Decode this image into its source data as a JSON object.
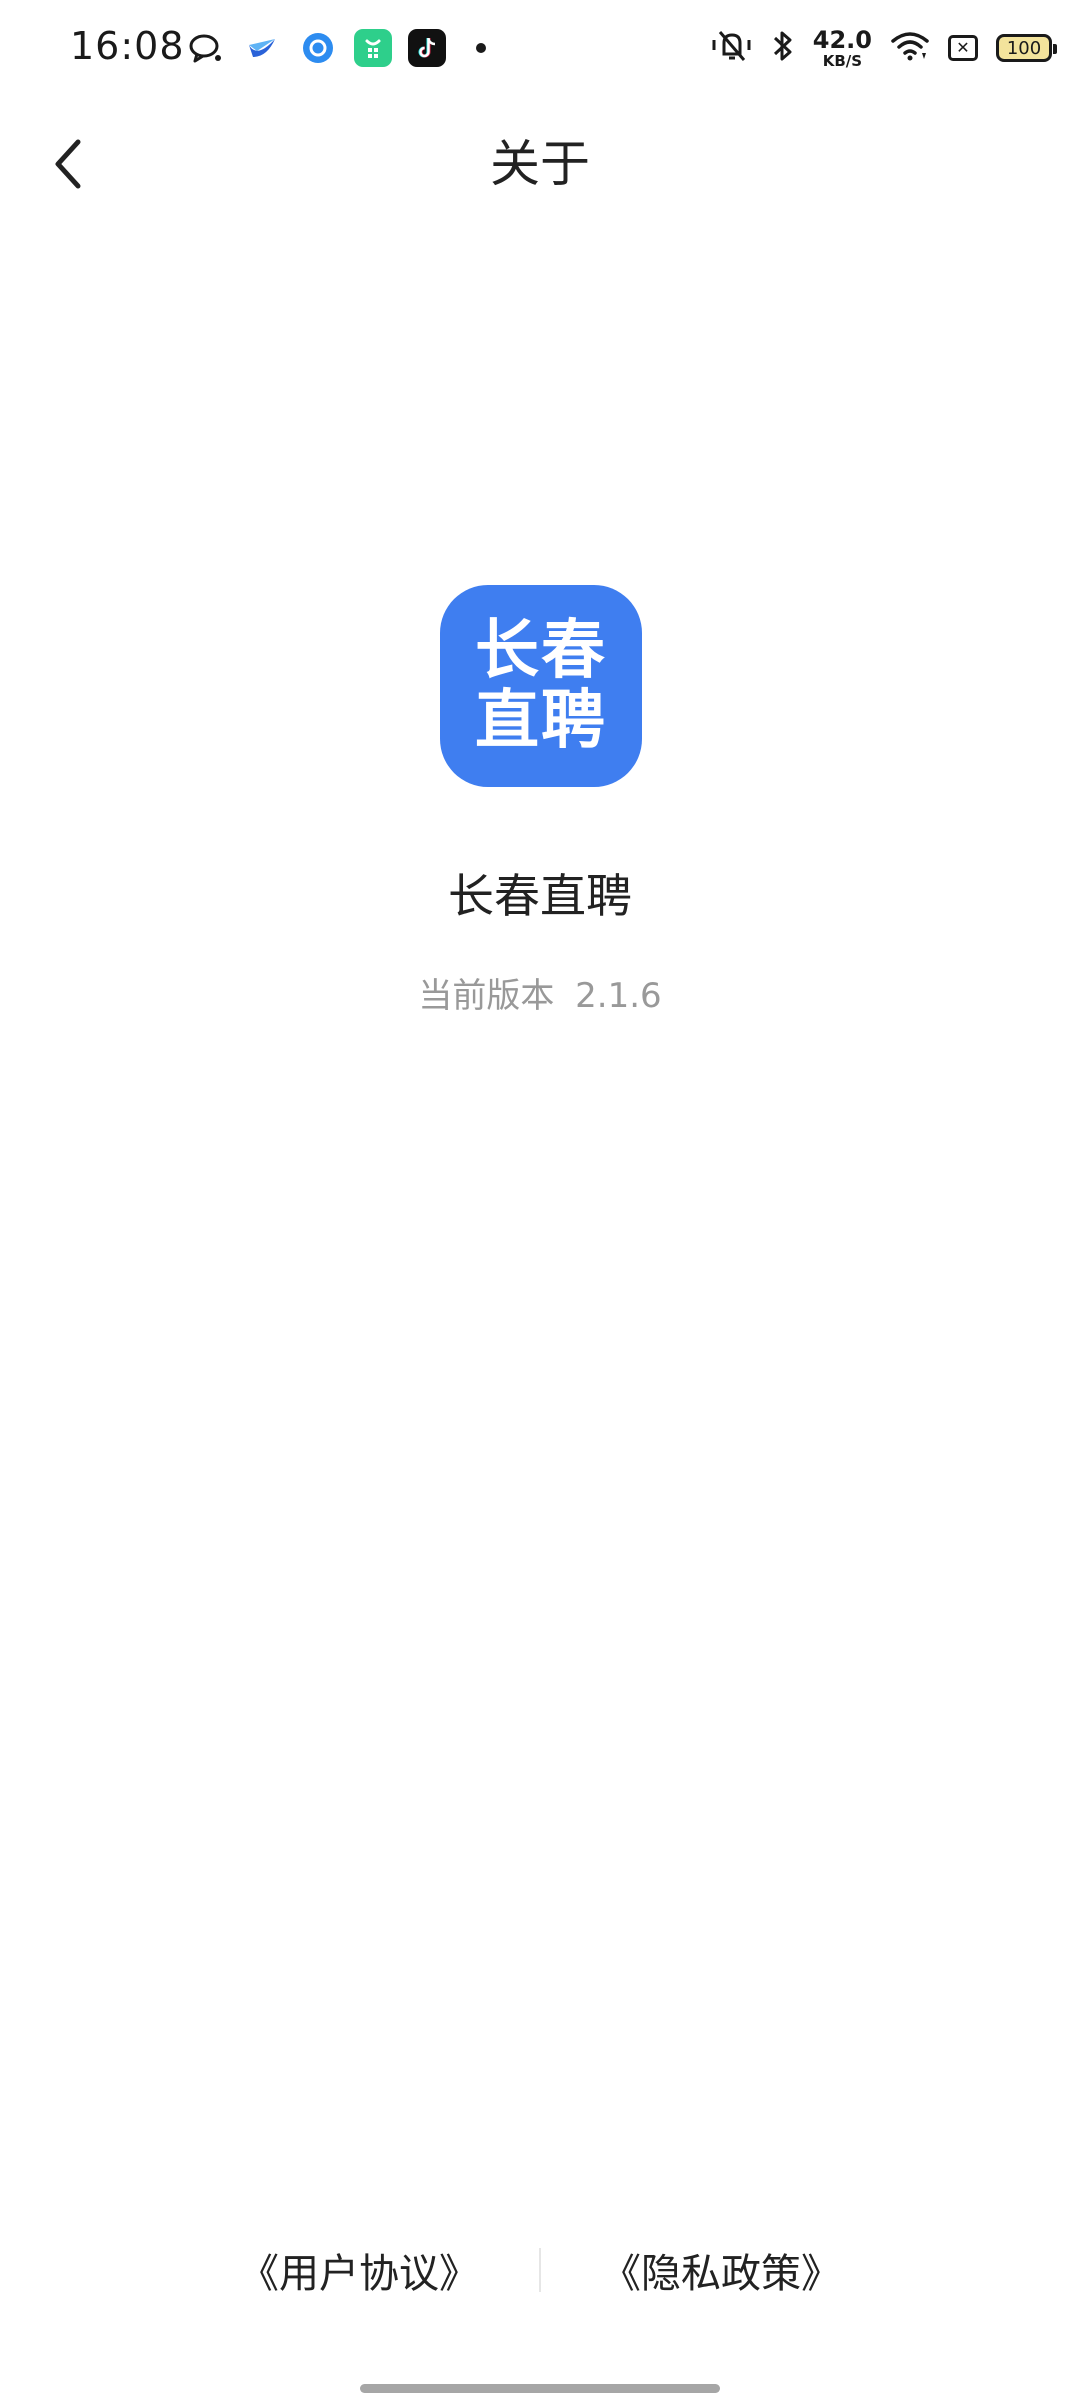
{
  "status_bar": {
    "time": "16:08",
    "net_speed_value": "42.0",
    "net_speed_unit": "KB/S",
    "battery_level": "100",
    "notification_icons": [
      "bubble-chat-icon",
      "blue-bird-app-icon",
      "blue-circle-app-icon",
      "green-shopping-app-icon",
      "tiktok-icon"
    ],
    "status_icons": [
      "mute-icon",
      "bluetooth-icon",
      "wifi-icon",
      "sim-none-icon",
      "battery-icon"
    ],
    "colors": {
      "battery_fill": "#f3e39c",
      "green_app": "#2ecf8b",
      "tiktok_bg": "#111111"
    }
  },
  "nav": {
    "title": "关于",
    "back_icon": "chevron-left-icon"
  },
  "app": {
    "logo_line1": "长春",
    "logo_line2": "直聘",
    "name": "长春直聘",
    "version_label": "当前版本",
    "version_number": "2.1.6",
    "brand_color": "#3f7ef0"
  },
  "footer": {
    "user_agreement": "《用户协议》",
    "privacy_policy": "《隐私政策》"
  }
}
